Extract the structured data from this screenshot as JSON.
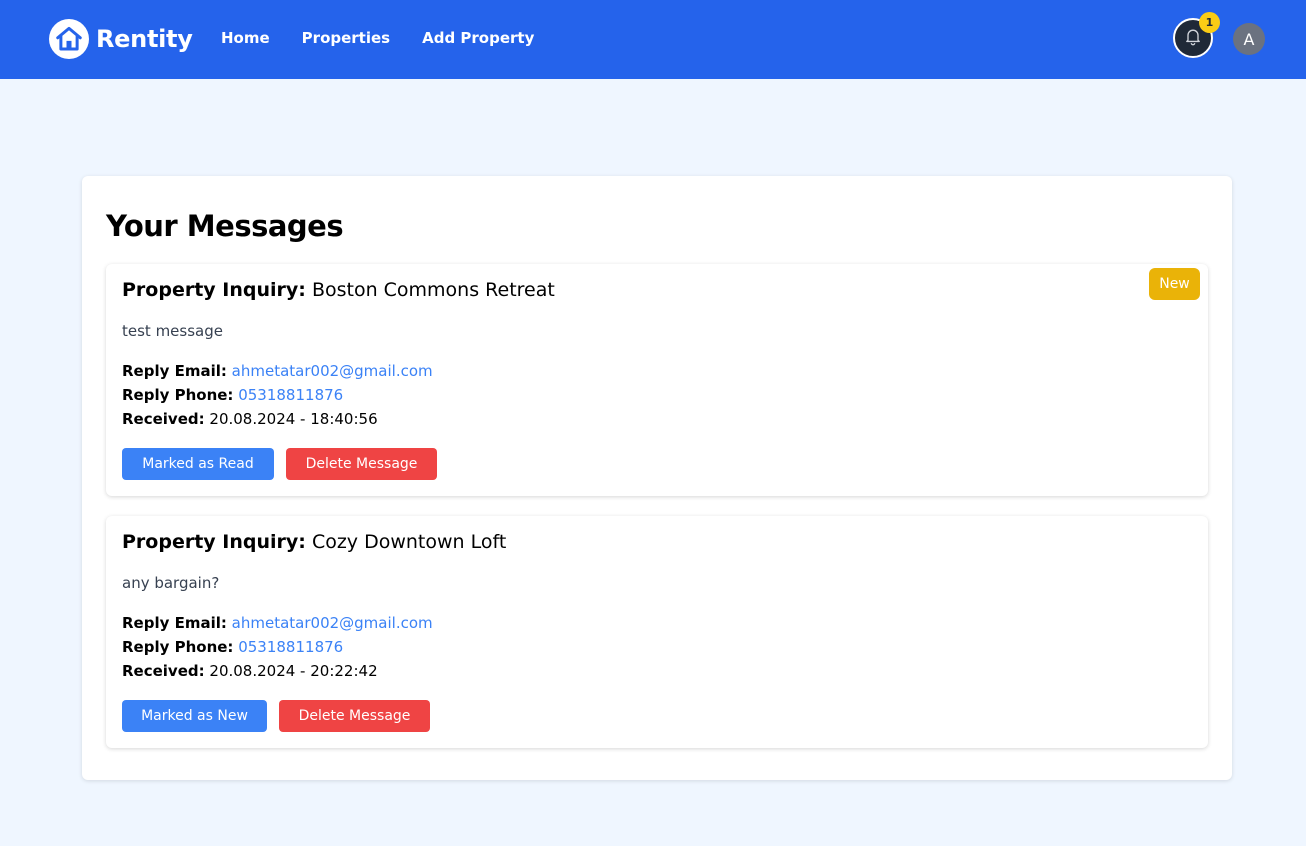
{
  "header": {
    "brand": "Rentity",
    "nav": [
      "Home",
      "Properties",
      "Add Property"
    ],
    "notification_count": "1",
    "avatar_initial": "A"
  },
  "page_title": "Your Messages",
  "messages": [
    {
      "heading_label": "Property Inquiry:",
      "property": "Boston Commons Retreat",
      "body": "test message",
      "email_label": "Reply Email:",
      "email": "ahmetatar002@gmail.com",
      "phone_label": "Reply Phone:",
      "phone": "05318811876",
      "received_label": "Received:",
      "received": "20.08.2024 - 18:40:56",
      "mark_button": "Marked as Read",
      "delete_button": "Delete Message",
      "badge": "New"
    },
    {
      "heading_label": "Property Inquiry:",
      "property": "Cozy Downtown Loft",
      "body": "any bargain?",
      "email_label": "Reply Email:",
      "email": "ahmetatar002@gmail.com",
      "phone_label": "Reply Phone:",
      "phone": "05318811876",
      "received_label": "Received:",
      "received": "20.08.2024 - 20:22:42",
      "mark_button": "Marked as New",
      "delete_button": "Delete Message"
    }
  ],
  "colors": {
    "navbar": "#2563eb",
    "background": "#eff6ff",
    "button_blue": "#3b82f6",
    "button_red": "#ef4444",
    "badge_yellow": "#eab308",
    "notification_badge": "#facc15"
  },
  "icons": {
    "logo": "house-icon",
    "notifications": "bell-icon"
  }
}
